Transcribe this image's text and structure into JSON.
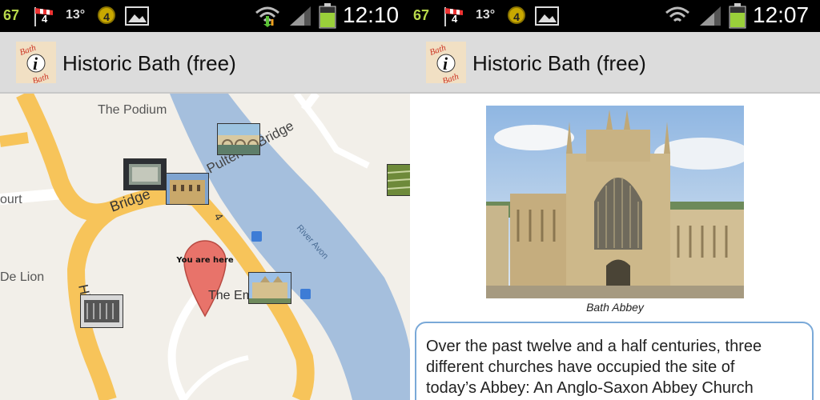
{
  "left_screen": {
    "status": {
      "battery_level": "67",
      "weather_temp": "13°",
      "notification_count": "4",
      "coin_value": "4",
      "time": "12:10"
    },
    "app": {
      "title": "Historic Bath (free)",
      "icon_text_top": "Bath",
      "icon_letter": "i",
      "icon_text_bottom": "Bath"
    },
    "map": {
      "labels": {
        "podium": "The Podium",
        "pulteney": "Pulteney Bridge",
        "bridge": "Bridge",
        "ourt": "ourt",
        "de_lion": "De Lion",
        "river": "River Avon",
        "the_em": "The Em",
        "hi": "Hi",
        "road_num": "4"
      },
      "pin_text": "You are here"
    }
  },
  "right_screen": {
    "status": {
      "battery_level": "67",
      "weather_temp": "13°",
      "notification_count": "4",
      "coin_value": "4",
      "time": "12:07"
    },
    "app": {
      "title": "Historic Bath (free)",
      "icon_text_top": "Bath",
      "icon_letter": "i",
      "icon_text_bottom": "Bath"
    },
    "photo_caption": "Bath Abbey",
    "body_text": "Over the past twelve and a half centuries, three\ndifferent churches have occupied the site of\ntoday’s Abbey: An Anglo-Saxon Abbey Church"
  },
  "colors": {
    "road": "#f7c45a",
    "river": "#a5bfdd",
    "map_bg": "#f2efe9",
    "pin": "#e8736a",
    "box_border": "#7aa9d8"
  }
}
